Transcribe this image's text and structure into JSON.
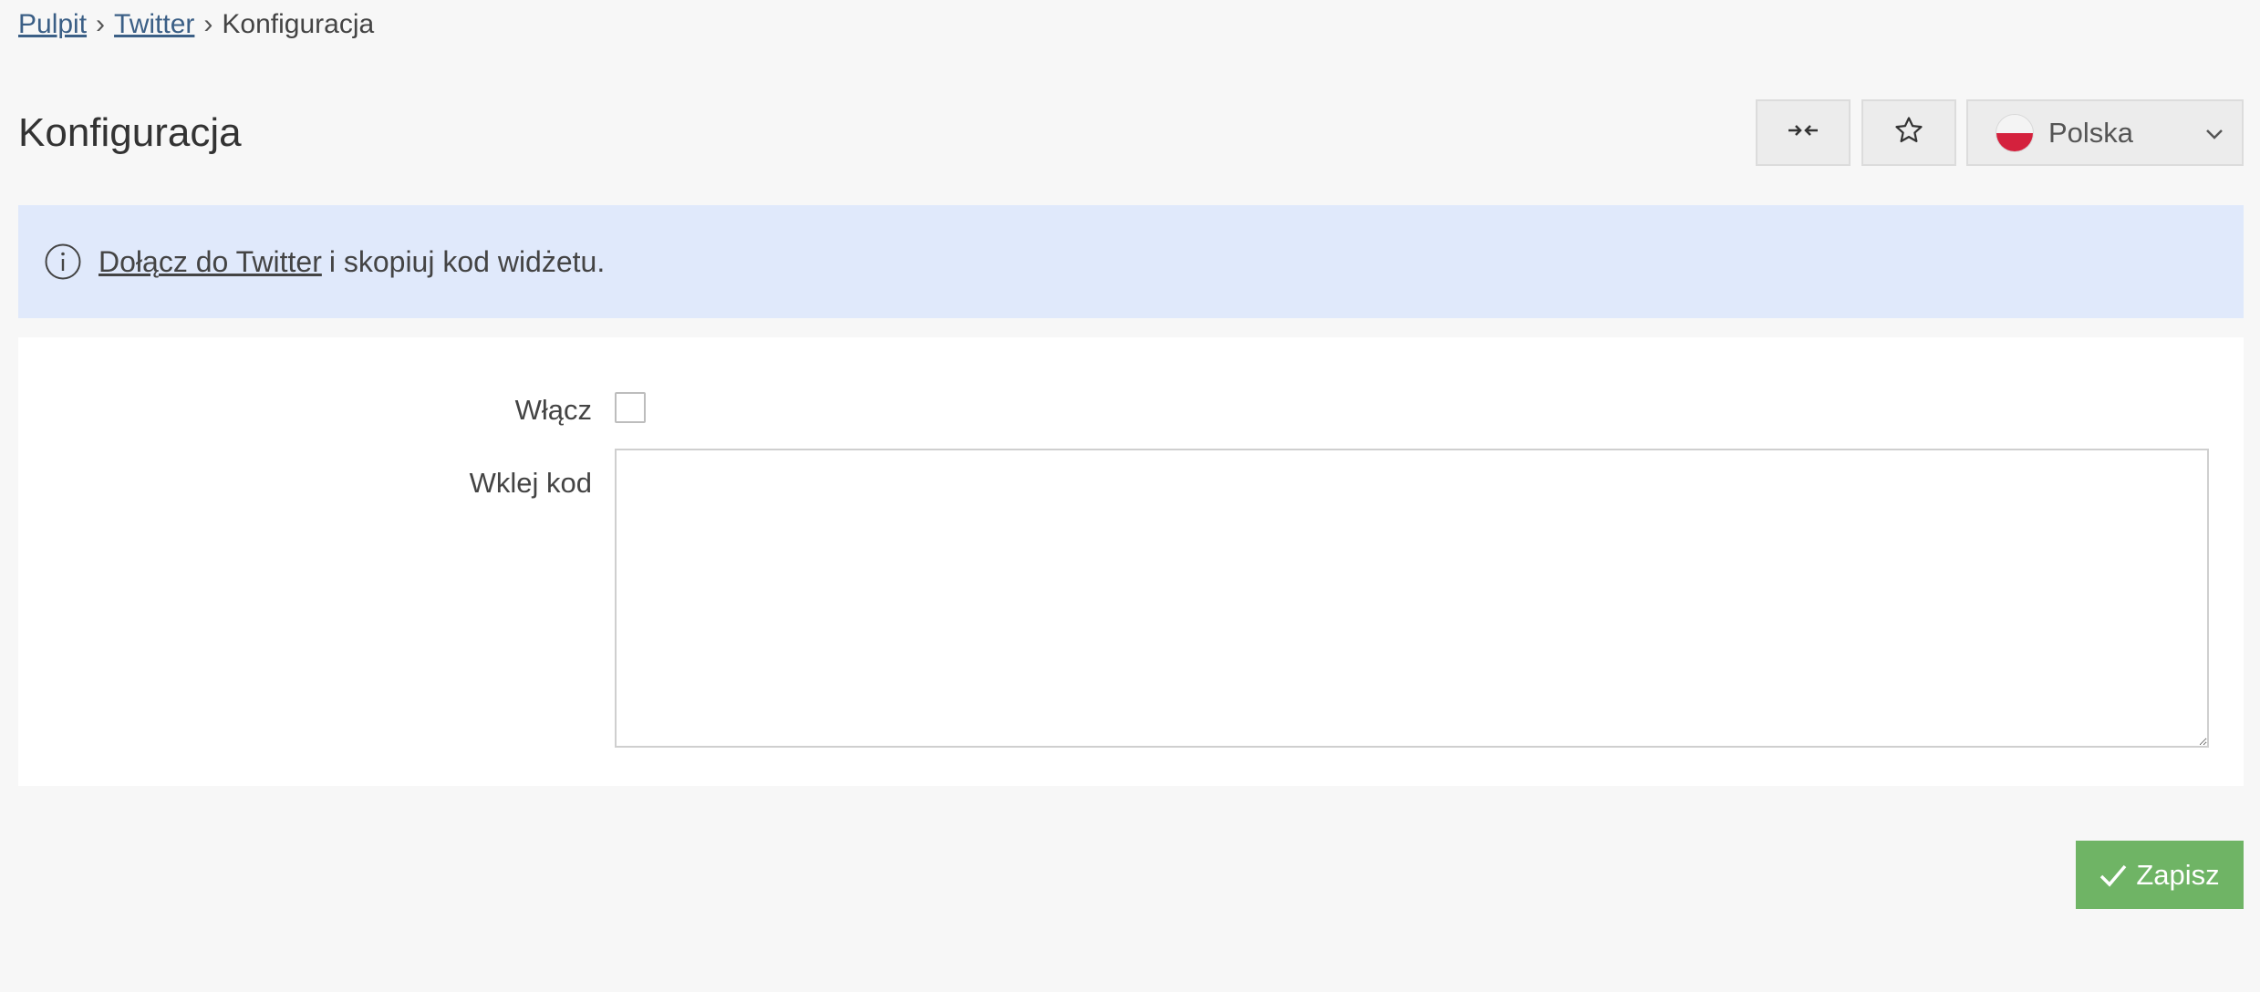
{
  "breadcrumb": {
    "items": [
      {
        "label": "Pulpit"
      },
      {
        "label": "Twitter"
      }
    ],
    "separator": "›",
    "current": "Konfiguracja"
  },
  "header": {
    "title": "Konfiguracja",
    "collapse_icon": "arrows-in-icon",
    "favorite_icon": "star-icon",
    "language": {
      "selected": "Polska",
      "flag": "poland-flag-icon",
      "icon": "chevron-down-icon"
    }
  },
  "alert": {
    "icon": "info-icon",
    "link_text": "Dołącz do Twitter",
    "text": "i skopiuj kod widżetu.",
    "background": "#e0e9fb"
  },
  "form": {
    "enable_label": "Włącz",
    "enable_checked": false,
    "code_label": "Wklej kod",
    "code_value": ""
  },
  "footer": {
    "save_label": "Zapisz",
    "save_icon": "check-icon",
    "save_color": "#6fb465"
  }
}
